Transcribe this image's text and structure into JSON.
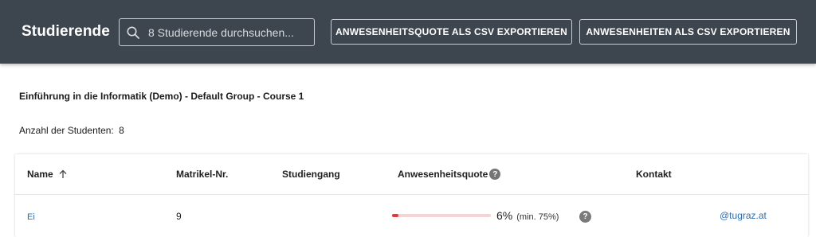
{
  "header": {
    "title": "Studierende",
    "search": {
      "placeholder": "8 Studierende durchsuchen...",
      "value": ""
    },
    "export_quote_label": "ANWESENHEITSQUOTE ALS CSV EXPORTIEREN",
    "export_attendance_label": "ANWESENHEITEN ALS CSV EXPORTIEREN"
  },
  "course": {
    "title": "Einführung in die Informatik (Demo) - Default Group - Course 1",
    "student_count_label": "Anzahl der Studenten:",
    "student_count": "8"
  },
  "table": {
    "columns": {
      "name": "Name",
      "matrikel": "Matrikel-Nr.",
      "studiengang": "Studiengang",
      "quote": "Anwesenheitsquote",
      "contact": "Kontakt"
    },
    "help_glyph": "?",
    "rows": [
      {
        "name": "Ei",
        "matrikel": "9",
        "studiengang": "",
        "quote_percent": "6%",
        "quote_fraction": 0.06,
        "quote_min": "(min. 75%)",
        "contact": "@tugraz.at"
      }
    ]
  },
  "colors": {
    "topbar": "#3d464e",
    "progress_fill": "#e0393e",
    "progress_track": "#f7d3d3",
    "link": "#2a6db4"
  }
}
